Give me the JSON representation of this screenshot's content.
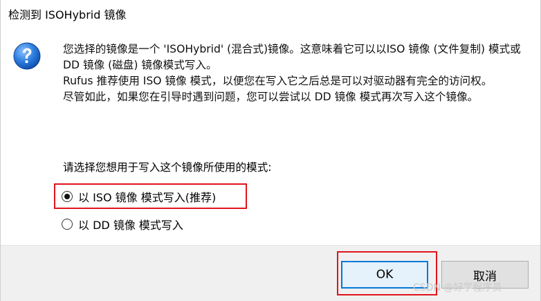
{
  "window": {
    "title": "检测到 ISOHybrid 镜像"
  },
  "message": {
    "paragraph1": "您选择的镜像是一个 'ISOHybrid' (混合式)镜像。这意味着它可以以ISO 镜像 (文件复制) 模式或 DD 镜像 (磁盘) 镜像模式写入。",
    "paragraph2": "Rufus 推荐使用 ISO 镜像 模式，以便您在写入它之后总是可以对驱动器有完全的访问权。",
    "paragraph3": "尽管如此，如果您在引导时遇到问题，您可以尝试以 DD 镜像 模式再次写入这个镜像。",
    "prompt": "请选择您想用于写入这个镜像所使用的模式:"
  },
  "options": {
    "iso_label": "以 ISO 镜像 模式写入(推荐)",
    "iso_selected": true,
    "dd_label": "以 DD 镜像 模式写入",
    "dd_selected": false
  },
  "buttons": {
    "ok_label": "OK",
    "cancel_label": "取消"
  },
  "watermark": {
    "text": "CSDN @好学程序员"
  },
  "colors": {
    "highlight": "#e0141b",
    "focus_border": "#0078d7",
    "footer_background": "#f0f0f0"
  },
  "icons": {
    "dialog_icon": "question-icon"
  }
}
